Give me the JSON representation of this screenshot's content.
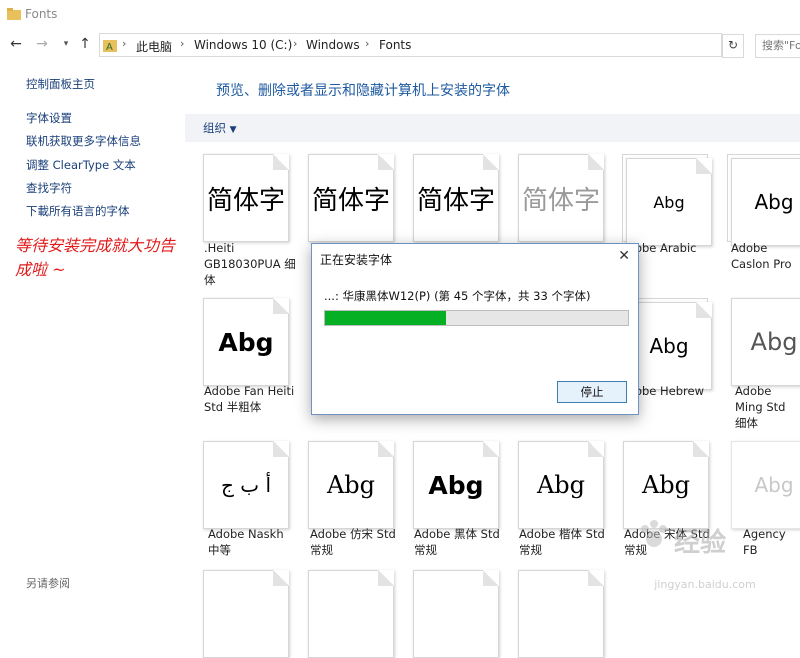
{
  "window": {
    "title": "Fonts"
  },
  "address": {
    "crumbs": [
      "此电脑",
      "Windows 10 (C:)",
      "Windows",
      "Fonts"
    ],
    "search_placeholder": "搜索\"Fo"
  },
  "sidebar": {
    "home": "控制面板主页",
    "links": [
      "字体设置",
      "联机获取更多字体信息",
      "调整 ClearType 文本",
      "查找字符",
      "下載所有语言的字体"
    ],
    "see_also": "另请参阅"
  },
  "annotation": "等待安装完成就大功告成啦 ~",
  "main": {
    "heading": "预览、删除或者显示和隐藏计算机上安装的字体",
    "organize": "组织"
  },
  "fonts": [
    {
      "sample": "简体字",
      "name": ".Heiti GB18030PUA 细体",
      "stack": false
    },
    {
      "sample": "简体字",
      "name": "",
      "stack": false
    },
    {
      "sample": "简体字",
      "name": "",
      "stack": false
    },
    {
      "sample": "简体字",
      "name": "",
      "stack": false
    },
    {
      "sample": "Abg",
      "name": "Adobe Arabic",
      "stack": true
    },
    {
      "sample": "Abg",
      "name": "Adobe Caslon Pro",
      "stack": true
    },
    {
      "sample": "Abg",
      "name": "Adobe Fan Heiti Std 半粗体",
      "stack": false
    },
    {
      "sample": "Abg",
      "name": "Adobe Hebrew",
      "stack": true
    },
    {
      "sample": "Abg",
      "name": "Adobe Ming Std 细体",
      "stack": false
    },
    {
      "sample": "أ ب ج",
      "name": "Adobe Naskh 中等",
      "stack": false
    },
    {
      "sample": "Abg",
      "name": "Adobe 仿宋 Std 常规",
      "stack": false
    },
    {
      "sample": "Abg",
      "name": "Adobe 黑体 Std 常规",
      "stack": false
    },
    {
      "sample": "Abg",
      "name": "Adobe 楷体 Std 常规",
      "stack": false
    },
    {
      "sample": "Abg",
      "name": "Adobe 宋体 Std 常规",
      "stack": false
    },
    {
      "sample": "Abg",
      "name": "Agency FB",
      "stack": false
    }
  ],
  "dialog": {
    "title": "正在安装字体",
    "status": "...: 华康黑体W12(P) (第 45 个字体，共 33 个字体)",
    "progress": 0.4,
    "stop_label": "停止"
  },
  "watermark": {
    "logo": "经验",
    "url": "jingyan.baidu.com"
  },
  "colors": {
    "accent": "#1e5aa0",
    "progress": "#06b025",
    "annotation": "#e11a1a"
  }
}
